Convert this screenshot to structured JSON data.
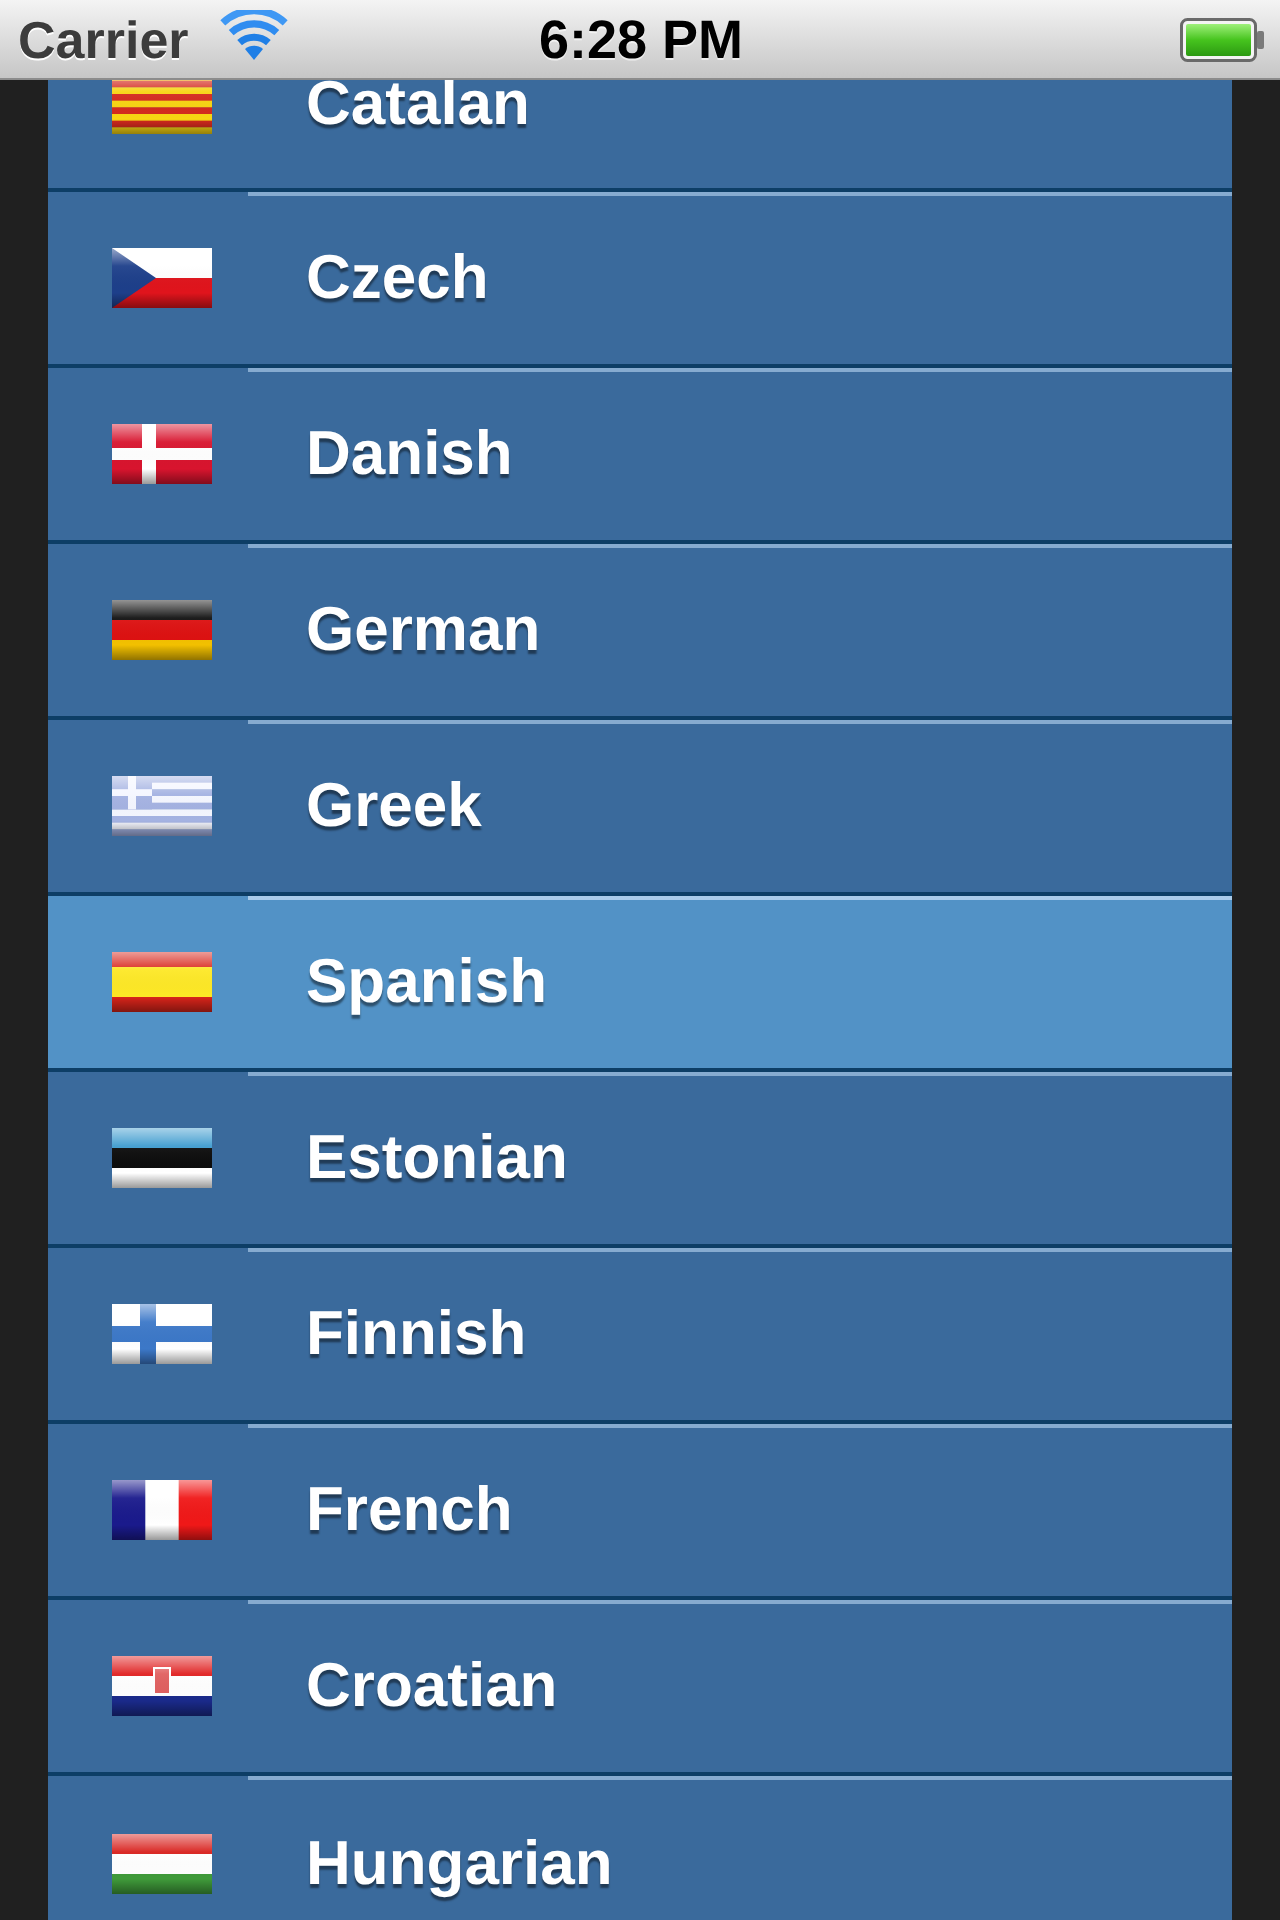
{
  "status_bar": {
    "carrier": "Carrier",
    "time": "6:28 PM"
  },
  "languages": [
    {
      "name": "Catalan",
      "kind": "catalonia",
      "selected": false
    },
    {
      "name": "Czech",
      "kind": "czech",
      "selected": false
    },
    {
      "name": "Danish",
      "kind": "denmark",
      "selected": false
    },
    {
      "name": "German",
      "kind": "germany",
      "selected": false
    },
    {
      "name": "Greek",
      "kind": "greece",
      "selected": false
    },
    {
      "name": "Spanish",
      "kind": "spain",
      "selected": true
    },
    {
      "name": "Estonian",
      "kind": "estonia",
      "selected": false
    },
    {
      "name": "Finnish",
      "kind": "finland",
      "selected": false
    },
    {
      "name": "French",
      "kind": "france",
      "selected": false
    },
    {
      "name": "Croatian",
      "kind": "croatia",
      "selected": false
    },
    {
      "name": "Hungarian",
      "kind": "hungary",
      "selected": false
    }
  ]
}
